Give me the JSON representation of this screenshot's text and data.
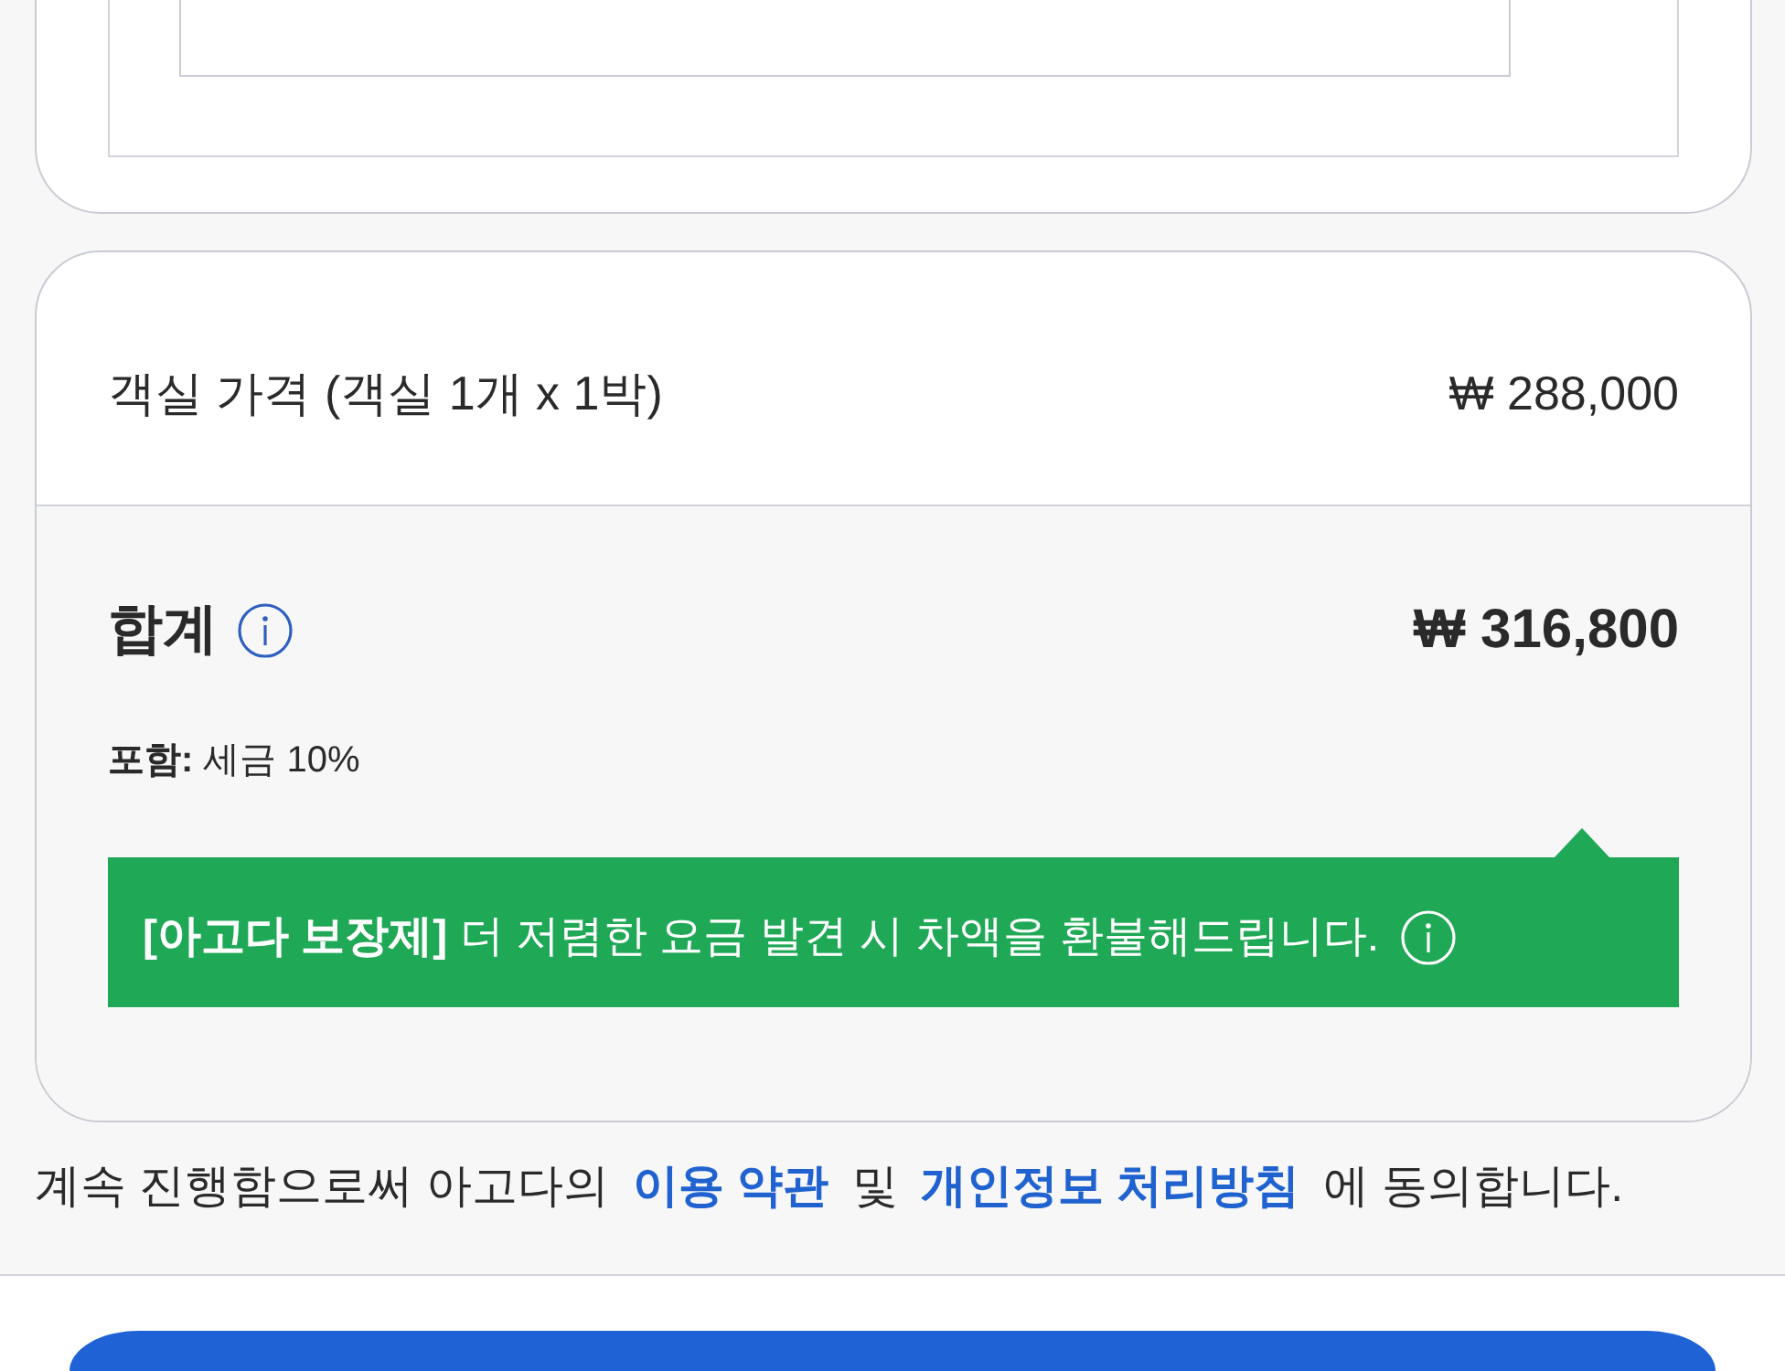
{
  "price_card": {
    "room_price": {
      "label": "객실 가격 (객실 1개 x 1박)",
      "amount": "₩ 288,000"
    },
    "total": {
      "label": "합계",
      "amount": "₩ 316,800",
      "included": "**포함:** 세금 10%"
    },
    "guarantee_banner": {
      "text": "**[아고다 보장제]** 더 저렴한 요금 발견 시 차액을 환불해드립니다."
    }
  },
  "agreement": {
    "parts": [
      {
        "kind": "text",
        "text": "계속 진행함으로써 아고다의"
      },
      {
        "kind": "link",
        "text": "이용 약관"
      },
      {
        "kind": "text",
        "text": "및"
      },
      {
        "kind": "link",
        "text": "개인정보 처리방침"
      },
      {
        "kind": "text",
        "text": "에 동의합니다."
      }
    ]
  }
}
